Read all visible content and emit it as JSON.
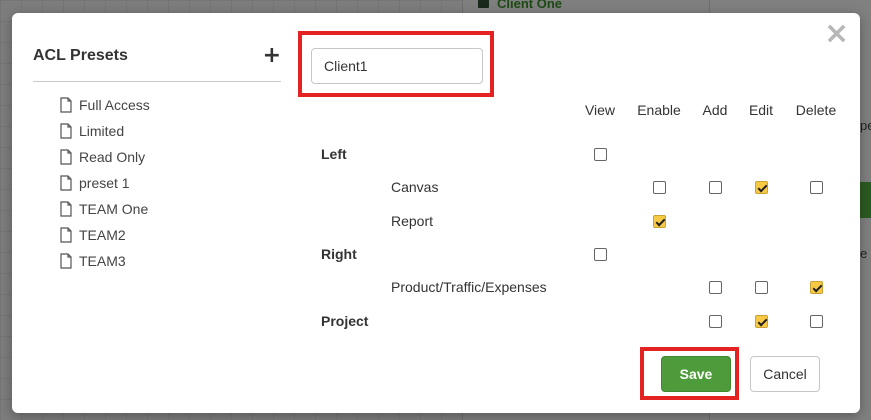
{
  "background": {
    "client_label": "Client One",
    "fragment_1": "pe",
    "fragment_2": "e"
  },
  "modal": {
    "close_icon": "close-icon",
    "left_panel": {
      "title": "ACL Presets",
      "add_icon": "plus-icon",
      "presets": [
        {
          "label": "Full Access",
          "icon": "file-icon"
        },
        {
          "label": "Limited",
          "icon": "file-icon"
        },
        {
          "label": "Read Only",
          "icon": "file-icon"
        },
        {
          "label": "preset 1",
          "icon": "file-icon"
        },
        {
          "label": "TEAM One",
          "icon": "file-icon"
        },
        {
          "label": "TEAM2",
          "icon": "file-icon"
        },
        {
          "label": "TEAM3",
          "icon": "file-icon"
        }
      ]
    },
    "name_input": {
      "value": "Client1",
      "placeholder": ""
    },
    "permissions": {
      "columns": [
        "View",
        "Enable",
        "Add",
        "Edit",
        "Delete"
      ],
      "rows": [
        {
          "label": "Left",
          "type": "group",
          "cells": {
            "View": false
          }
        },
        {
          "label": "Canvas",
          "type": "sub",
          "cells": {
            "Enable": false,
            "Add": false,
            "Edit": true,
            "Delete": false
          }
        },
        {
          "label": "Report",
          "type": "sub",
          "cells": {
            "Enable": true
          }
        },
        {
          "label": "Right",
          "type": "group",
          "cells": {
            "View": false
          }
        },
        {
          "label": "Product/Traffic/Expenses",
          "type": "sub",
          "cells": {
            "Add": false,
            "Edit": false,
            "Delete": true
          }
        },
        {
          "label": "Project",
          "type": "group",
          "cells": {
            "Add": false,
            "Edit": true,
            "Delete": false
          }
        }
      ]
    },
    "buttons": {
      "save": "Save",
      "cancel": "Cancel"
    },
    "colors": {
      "save_bg": "#4d9b3a",
      "checked_bg": "#f7c945",
      "highlight": "#e32222"
    }
  }
}
